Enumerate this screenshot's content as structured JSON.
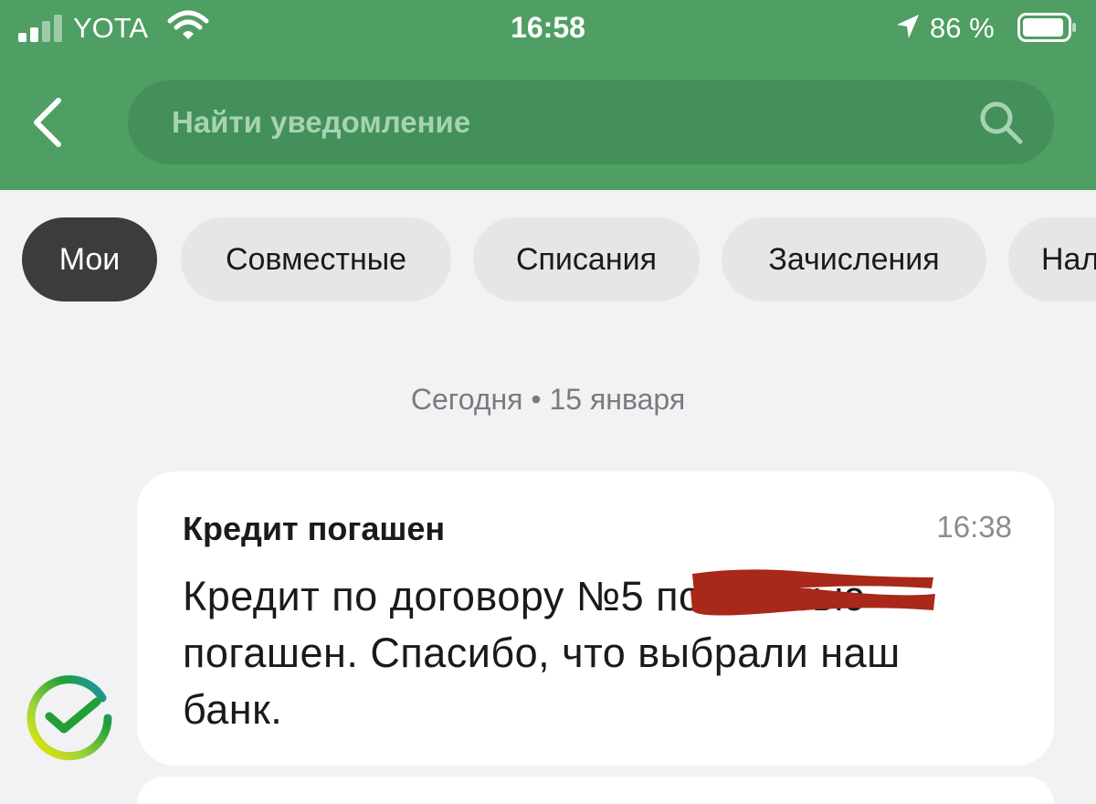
{
  "status_bar": {
    "carrier": "YOTA",
    "time": "16:58",
    "battery_percent": "86 %"
  },
  "header": {
    "search": {
      "placeholder": "Найти уведомление"
    }
  },
  "tabs": [
    {
      "label": "Мои",
      "active": true
    },
    {
      "label": "Совместные",
      "active": false
    },
    {
      "label": "Списания",
      "active": false
    },
    {
      "label": "Зачисления",
      "active": false
    },
    {
      "label": "Нал",
      "active": false
    }
  ],
  "feed": {
    "date_separator": "Сегодня • 15 января",
    "notifications": [
      {
        "title": "Кредит погашен",
        "time": "16:38",
        "body": "Кредит по договору №5 полностью погашен. Спасибо, что выбрали наш банк."
      }
    ]
  },
  "colors": {
    "header_green": "#4f9e63",
    "search_green": "#43905a",
    "active_chip": "#3c3c3c",
    "redaction_red": "#a8281a"
  },
  "icons": [
    "signal-icon",
    "wifi-icon",
    "location-arrow-icon",
    "battery-icon",
    "back-arrow-icon",
    "search-icon",
    "sber-logo-icon"
  ]
}
